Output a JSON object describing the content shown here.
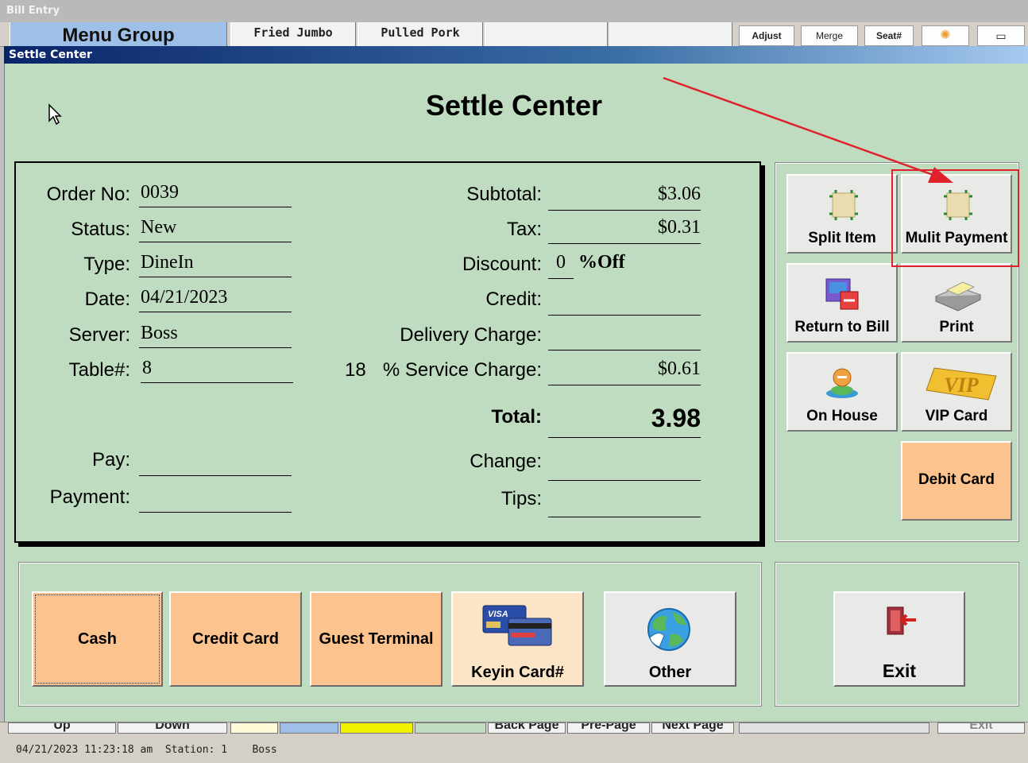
{
  "background_window": {
    "title": "Bill Entry",
    "menu_group_tab": "Menu Group",
    "item_tabs": [
      "Fried Jumbo",
      "Pulled Pork"
    ],
    "small_buttons": [
      "Adjust",
      "Merge",
      "Seat#"
    ],
    "bottom_buttons": [
      "Up",
      "Down",
      "Back Page",
      "Pre-Page",
      "Next Page",
      "Exit"
    ]
  },
  "dialog": {
    "title": "Settle Center",
    "heading": "Settle Center"
  },
  "order": {
    "order_no_label": "Order No:",
    "order_no": "0039",
    "status_label": "Status:",
    "status": "New",
    "type_label": "Type:",
    "type": "DineIn",
    "date_label": "Date:",
    "date": "04/21/2023",
    "server_label": "Server:",
    "server": "Boss",
    "table_label": "Table#:",
    "table": "8",
    "pay_label": "Pay:",
    "pay": "",
    "payment_label": "Payment:",
    "payment": ""
  },
  "totals": {
    "subtotal_label": "Subtotal:",
    "subtotal": "$3.06",
    "tax_label": "Tax:",
    "tax": "$0.31",
    "discount_label": "Discount:",
    "discount": "0",
    "discount_unit": "%Off",
    "credit_label": "Credit:",
    "credit": "",
    "delivery_label": "Delivery Charge:",
    "delivery": "",
    "service_pct": "18",
    "service_label": "% Service Charge:",
    "service": "$0.61",
    "total_label": "Total:",
    "total": "3.98",
    "change_label": "Change:",
    "change": "",
    "tips_label": "Tips:",
    "tips": ""
  },
  "actions": {
    "split_item": "Split Item",
    "multi_payment": "Mulit Payment",
    "return_to_bill": "Return to Bill",
    "print": "Print",
    "on_house": "On House",
    "vip_card": "VIP Card",
    "vip_icon_text": "VIP",
    "debit_card": "Debit Card"
  },
  "payments": {
    "cash": "Cash",
    "credit_card": "Credit Card",
    "guest_terminal": "Guest Terminal",
    "keyin_card": "Keyin Card#",
    "card_brand": "VISA",
    "other": "Other",
    "exit": "Exit"
  },
  "status_bar": {
    "datetime": "04/21/2023 11:23:18 am",
    "station": "Station: 1",
    "user": "Boss"
  },
  "colors": {
    "dialog_bg": "#bfdcc0",
    "accent_orange": "#fcc38f",
    "annotation_red": "#e0202a"
  }
}
